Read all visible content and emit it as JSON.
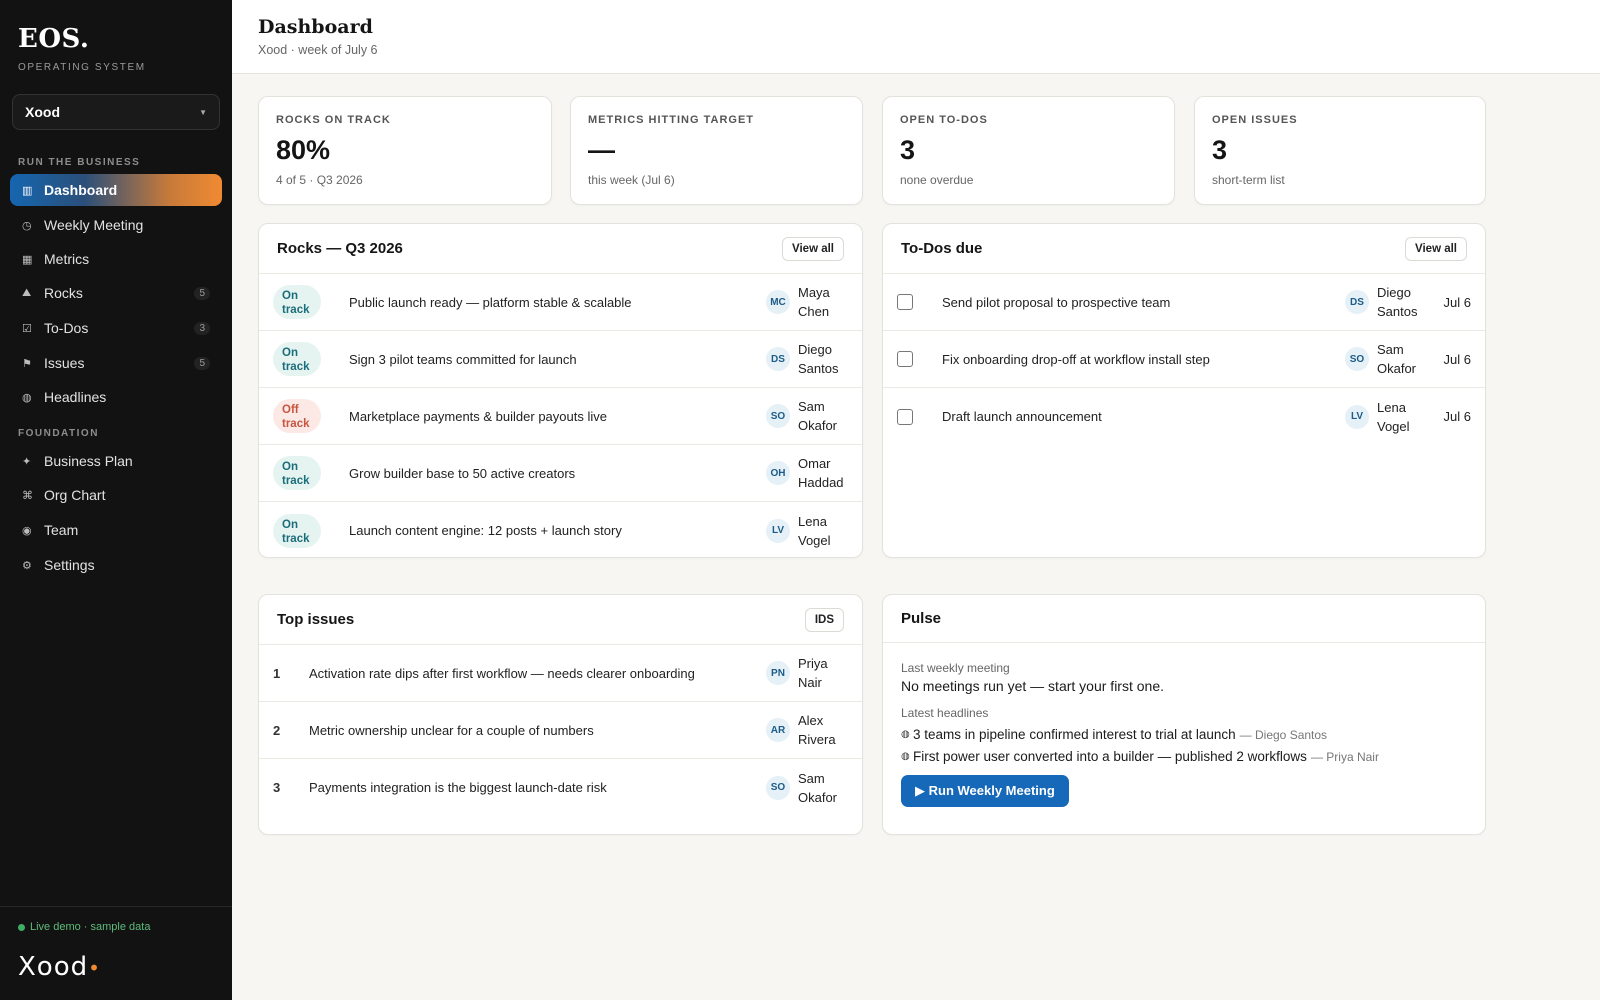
{
  "sidebar": {
    "logo": "EOS.",
    "logo_sub": "OPERATING SYSTEM",
    "org": "Xood",
    "section_run": "RUN THE BUSINESS",
    "section_foundation": "FOUNDATION",
    "items": [
      {
        "label": "Dashboard",
        "icon": "▥",
        "badge": ""
      },
      {
        "label": "Weekly Meeting",
        "icon": "◷",
        "badge": ""
      },
      {
        "label": "Metrics",
        "icon": "▦",
        "badge": ""
      },
      {
        "label": "Rocks",
        "icon": "⛰",
        "badge": "5"
      },
      {
        "label": "To-Dos",
        "icon": "☑",
        "badge": "3"
      },
      {
        "label": "Issues",
        "icon": "⚑",
        "badge": "5"
      },
      {
        "label": "Headlines",
        "icon": "◍",
        "badge": ""
      }
    ],
    "foundation": [
      {
        "label": "Business Plan",
        "icon": "✦"
      },
      {
        "label": "Org Chart",
        "icon": "⌘"
      },
      {
        "label": "Team",
        "icon": "◉"
      },
      {
        "label": "Settings",
        "icon": "⚙"
      }
    ],
    "live_demo": "Live demo · sample data",
    "brand": "Xood"
  },
  "header": {
    "title": "Dashboard",
    "subtitle": "Xood · week of July 6"
  },
  "stats": [
    {
      "label": "ROCKS ON TRACK",
      "value": "80%",
      "sub": "4 of 5 · Q3 2026"
    },
    {
      "label": "METRICS HITTING TARGET",
      "value": "—",
      "sub": "this week (Jul 6)"
    },
    {
      "label": "OPEN TO-DOS",
      "value": "3",
      "sub": "none overdue"
    },
    {
      "label": "OPEN ISSUES",
      "value": "3",
      "sub": "short-term list"
    }
  ],
  "rocks": {
    "title": "Rocks — Q3 2026",
    "button": "View all",
    "items": [
      {
        "status_1": "On",
        "status_2": "track",
        "status": "on",
        "text": "Public launch ready — platform stable & scalable",
        "initials": "MC",
        "first": "Maya",
        "last": "Chen"
      },
      {
        "status_1": "On",
        "status_2": "track",
        "status": "on",
        "text": "Sign 3 pilot teams committed for launch",
        "initials": "DS",
        "first": "Diego",
        "last": "Santos"
      },
      {
        "status_1": "Off",
        "status_2": "track",
        "status": "off",
        "text": "Marketplace payments & builder payouts live",
        "initials": "SO",
        "first": "Sam",
        "last": "Okafor"
      },
      {
        "status_1": "On",
        "status_2": "track",
        "status": "on",
        "text": "Grow builder base to 50 active creators",
        "initials": "OH",
        "first": "Omar",
        "last": "Haddad"
      },
      {
        "status_1": "On",
        "status_2": "track",
        "status": "on",
        "text": "Launch content engine: 12 posts + launch story",
        "initials": "LV",
        "first": "Lena",
        "last": "Vogel"
      }
    ]
  },
  "todos": {
    "title": "To-Dos due",
    "button": "View all",
    "items": [
      {
        "text": "Send pilot proposal to prospective team",
        "initials": "DS",
        "first": "Diego",
        "last": "Santos",
        "due": "Jul 6"
      },
      {
        "text": "Fix onboarding drop-off at workflow install step",
        "initials": "SO",
        "first": "Sam",
        "last": "Okafor",
        "due": "Jul 6"
      },
      {
        "text": "Draft launch announcement",
        "initials": "LV",
        "first": "Lena",
        "last": "Vogel",
        "due": "Jul 6"
      }
    ]
  },
  "issues": {
    "title": "Top issues",
    "button": "IDS",
    "items": [
      {
        "num": "1",
        "text": "Activation rate dips after first workflow — needs clearer onboarding",
        "initials": "PN",
        "first": "Priya",
        "last": "Nair"
      },
      {
        "num": "2",
        "text": "Metric ownership unclear for a couple of numbers",
        "initials": "AR",
        "first": "Alex",
        "last": "Rivera"
      },
      {
        "num": "3",
        "text": "Payments integration is the biggest launch-date risk",
        "initials": "SO",
        "first": "Sam",
        "last": "Okafor"
      }
    ]
  },
  "pulse": {
    "title": "Pulse",
    "meeting_label": "Last weekly meeting",
    "meeting_text": "No meetings run yet — start your first one.",
    "headlines_label": "Latest headlines",
    "headlines": [
      {
        "text": "3 teams in pipeline confirmed interest to trial at launch",
        "by": "— Diego Santos"
      },
      {
        "text": "First power user converted into a builder — published 2 workflows",
        "by": "— Priya Nair"
      }
    ],
    "run_button": "▶ Run Weekly Meeting"
  },
  "colors": {
    "accent": "#1668b8",
    "on_track": "#1a6d7a",
    "off_track": "#c7543f",
    "live": "#3fae63"
  }
}
